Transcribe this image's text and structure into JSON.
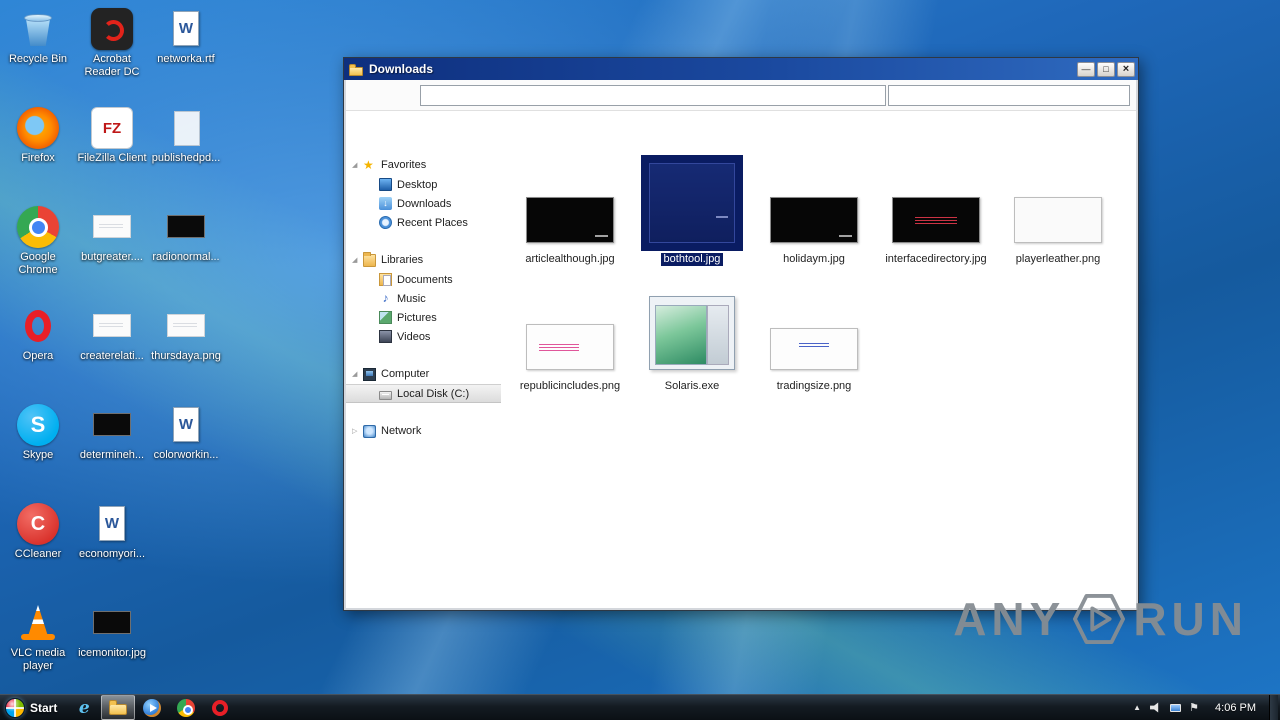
{
  "desktop": {
    "icons": [
      {
        "label": "Recycle Bin",
        "icon": "recycle-bin",
        "col": 0,
        "row": 0
      },
      {
        "label": "Acrobat Reader DC",
        "icon": "acrobat-reader",
        "col": 1,
        "row": 0
      },
      {
        "label": "networka.rtf",
        "icon": "word-document",
        "col": 2,
        "row": 0
      },
      {
        "label": "Firefox",
        "icon": "firefox",
        "col": 0,
        "row": 1
      },
      {
        "label": "FileZilla Client",
        "icon": "filezilla",
        "col": 1,
        "row": 1
      },
      {
        "label": "publishedpd...",
        "icon": "document-faded",
        "col": 2,
        "row": 1
      },
      {
        "label": "Google Chrome",
        "icon": "chrome",
        "col": 0,
        "row": 2
      },
      {
        "label": "butgreater....",
        "icon": "image-faded",
        "col": 1,
        "row": 2
      },
      {
        "label": "radionormal...",
        "icon": "image-black",
        "col": 2,
        "row": 2
      },
      {
        "label": "Opera",
        "icon": "opera",
        "col": 0,
        "row": 3
      },
      {
        "label": "createrelati...",
        "icon": "image-faded",
        "col": 1,
        "row": 3
      },
      {
        "label": "thursdaya.png",
        "icon": "image-faded",
        "col": 2,
        "row": 3
      },
      {
        "label": "Skype",
        "icon": "skype",
        "col": 0,
        "row": 4
      },
      {
        "label": "determineh...",
        "icon": "image-black",
        "col": 1,
        "row": 4
      },
      {
        "label": "colorworkin...",
        "icon": "word-document",
        "col": 2,
        "row": 4
      },
      {
        "label": "CCleaner",
        "icon": "ccleaner",
        "col": 0,
        "row": 5
      },
      {
        "label": "economyori...",
        "icon": "word-document",
        "col": 1,
        "row": 5
      },
      {
        "label": "VLC media player",
        "icon": "vlc",
        "col": 0,
        "row": 6
      },
      {
        "label": "icemonitor.jpg",
        "icon": "image-black",
        "col": 1,
        "row": 6
      }
    ]
  },
  "explorer": {
    "title": "Downloads",
    "controls": {
      "minimize": "—",
      "maximize": "□",
      "close": "×"
    },
    "address_value": "",
    "search_value": "",
    "sidebar": {
      "sections": [
        {
          "label": "Favorites",
          "icon": "star",
          "expanded": true,
          "items": [
            {
              "label": "Desktop",
              "icon": "desktop"
            },
            {
              "label": "Downloads",
              "icon": "downloads"
            },
            {
              "label": "Recent Places",
              "icon": "recent"
            }
          ]
        },
        {
          "label": "Libraries",
          "icon": "folder",
          "expanded": true,
          "items": [
            {
              "label": "Documents",
              "icon": "documents"
            },
            {
              "label": "Music",
              "icon": "music"
            },
            {
              "label": "Pictures",
              "icon": "pictures"
            },
            {
              "label": "Videos",
              "icon": "videos"
            }
          ]
        },
        {
          "label": "Computer",
          "icon": "computer",
          "expanded": true,
          "items": [
            {
              "label": "Local Disk (C:)",
              "icon": "disk",
              "selected": true
            }
          ]
        },
        {
          "label": "Network",
          "icon": "network",
          "expanded": false,
          "items": []
        }
      ]
    },
    "files": [
      {
        "name": "articlealthough.jpg",
        "thumb": "black",
        "row": 0
      },
      {
        "name": "bothtool.jpg",
        "thumb": "navy",
        "row": 0,
        "selected": true
      },
      {
        "name": "holidaym.jpg",
        "thumb": "black",
        "row": 0
      },
      {
        "name": "interfacedirectory.jpg",
        "thumb": "black-red",
        "row": 0
      },
      {
        "name": "playerleather.png",
        "thumb": "white",
        "row": 0
      },
      {
        "name": "republicincludes.png",
        "thumb": "white-pink",
        "row": 1
      },
      {
        "name": "Solaris.exe",
        "thumb": "app",
        "row": 1
      },
      {
        "name": "tradingsize.png",
        "thumb": "white-blue",
        "row": 1
      }
    ]
  },
  "taskbar": {
    "start_label": "Start",
    "apps": [
      {
        "icon": "internet-explorer"
      },
      {
        "icon": "windows-explorer",
        "active": true
      },
      {
        "icon": "media-player"
      },
      {
        "icon": "chrome"
      },
      {
        "icon": "opera"
      }
    ],
    "tray": [
      {
        "icon": "hidden-icons"
      },
      {
        "icon": "volume"
      },
      {
        "icon": "network"
      },
      {
        "icon": "action-center"
      }
    ],
    "clock": "4:06 PM"
  },
  "watermark": {
    "left": "ANY",
    "right": "RUN"
  }
}
